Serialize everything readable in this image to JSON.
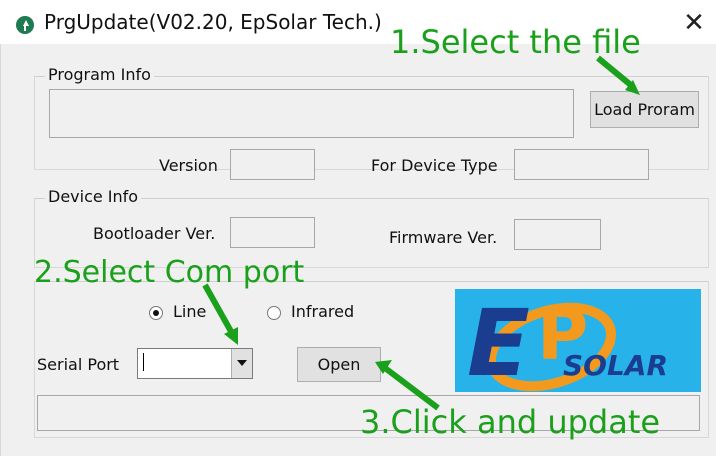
{
  "window": {
    "title": "PrgUpdate(V02.20, EpSolar Tech.)",
    "close_symbol": "✕"
  },
  "program_info": {
    "legend": "Program Info",
    "load_button": "Load Proram",
    "version_label": "Version",
    "device_type_label": "For Device Type"
  },
  "device_info": {
    "legend": "Device Info",
    "bootloader_label": "Bootloader Ver.",
    "firmware_label": "Firmware Ver."
  },
  "connection": {
    "radio_line": "Line",
    "radio_infrared": "Infrared",
    "selected_mode": "Line",
    "serial_port_label": "Serial Port",
    "open_button": "Open"
  },
  "logo": {
    "text": "SOLAR",
    "mark": "EP"
  },
  "annotations": {
    "step1": "1.Select the file",
    "step2": "2.Select Com port",
    "step3": "3.Click and update",
    "color": "#1ba01b"
  }
}
